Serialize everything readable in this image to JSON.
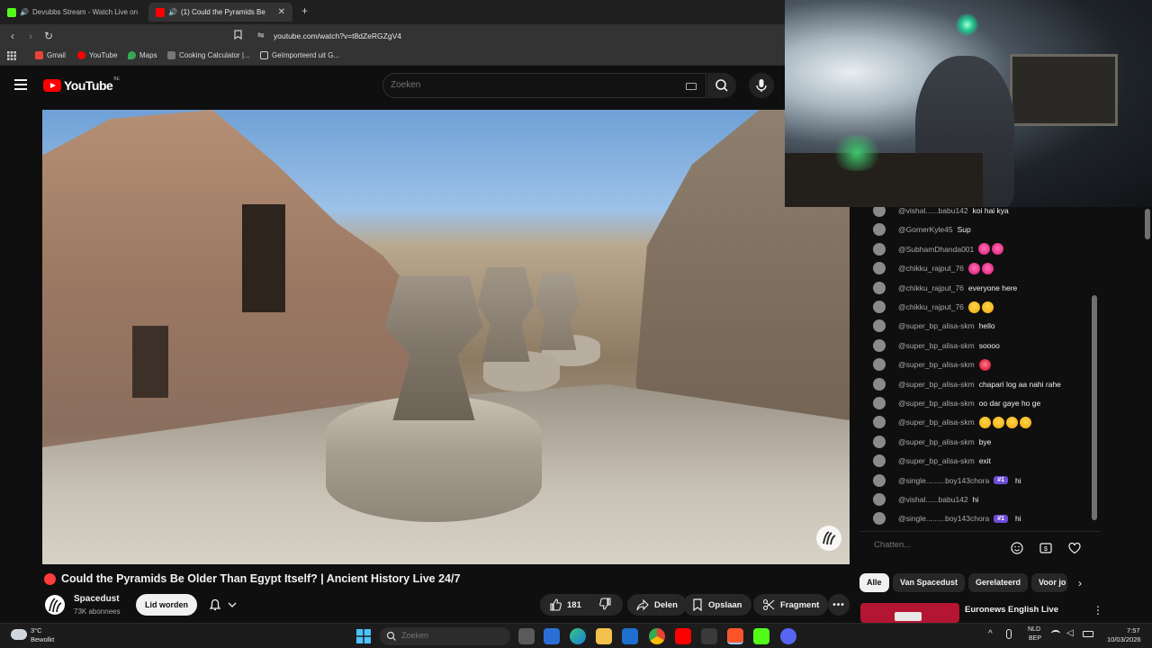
{
  "browser": {
    "tabs": [
      {
        "label": "Devubbs Stream - Watch Live on",
        "favicon_color": "#53fc18"
      },
      {
        "label": "(1)  Could the Pyramids Be",
        "favicon_color": "#ff0000"
      }
    ],
    "url": "youtube.com/watch?v=t8dZeRGZgV4",
    "bookmarks": [
      {
        "label": "Gmail",
        "icon": "gmail-icon"
      },
      {
        "label": "YouTube",
        "icon": "youtube-icon"
      },
      {
        "label": "Maps",
        "icon": "maps-icon"
      },
      {
        "label": "Cooking Calculator |...",
        "icon": "cooking-icon"
      },
      {
        "label": "Geïmporteerd uit G...",
        "icon": "folder-icon"
      }
    ]
  },
  "youtube": {
    "logo_text": "YouTube",
    "country_code": "BE",
    "search_placeholder": "Zoeken"
  },
  "video": {
    "title": "Could the Pyramids Be Older Than Egypt Itself? | Ancient History Live 24/7",
    "channel": "Spacedust",
    "subscribers": "73K abonnees",
    "join_label": "Lid worden",
    "likes": "181",
    "share_label": "Delen",
    "save_label": "Opslaan",
    "clip_label": "Fragment"
  },
  "chat": {
    "messages": [
      {
        "author": "@vishal......babu142",
        "text": "koi hai kya",
        "badge": "",
        "emoji": []
      },
      {
        "author": "@GomerKyle45",
        "text": "Sup",
        "badge": "",
        "emoji": []
      },
      {
        "author": "@SubhamDhanda001",
        "text": "",
        "badge": "",
        "emoji": [
          "hand",
          "hand"
        ]
      },
      {
        "author": "@chikku_rajput_76",
        "text": "",
        "badge": "",
        "emoji": [
          "hand",
          "hand"
        ]
      },
      {
        "author": "@chikku_rajput_76",
        "text": "everyone here",
        "badge": "",
        "emoji": []
      },
      {
        "author": "@chikku_rajput_76",
        "text": "",
        "badge": "",
        "emoji": [
          "laugh",
          "laugh"
        ]
      },
      {
        "author": "@super_bp_alisa-skm",
        "text": "hello",
        "badge": "",
        "emoji": []
      },
      {
        "author": "@super_bp_alisa-skm",
        "text": "soooo",
        "badge": "",
        "emoji": []
      },
      {
        "author": "@super_bp_alisa-skm",
        "text": "",
        "badge": "",
        "emoji": [
          "kiss"
        ]
      },
      {
        "author": "@super_bp_alisa-skm",
        "text": "chapari log aa nahi rahe",
        "badge": "",
        "emoji": []
      },
      {
        "author": "@super_bp_alisa-skm",
        "text": "oo dar gaye ho ge",
        "badge": "",
        "emoji": []
      },
      {
        "author": "@super_bp_alisa-skm",
        "text": "",
        "badge": "",
        "emoji": [
          "laugh",
          "laugh",
          "laugh",
          "laugh"
        ]
      },
      {
        "author": "@super_bp_alisa-skm",
        "text": "bye",
        "badge": "",
        "emoji": []
      },
      {
        "author": "@super_bp_alisa-skm",
        "text": "exit",
        "badge": "",
        "emoji": []
      },
      {
        "author": "@single.........boy143chora",
        "text": "hi",
        "badge": "#1",
        "emoji": []
      },
      {
        "author": "@vishal......babu142",
        "text": "hi",
        "badge": "",
        "emoji": []
      },
      {
        "author": "@single.........boy143chora",
        "text": "hi",
        "badge": "#1",
        "emoji": []
      }
    ],
    "input_placeholder": "Chatten..."
  },
  "chips": [
    "Alle",
    "Van Spacedust",
    "Gerelateerd",
    "Voor jo"
  ],
  "suggestion": {
    "title": "Euronews English Live"
  },
  "taskbar": {
    "weather_temp": "3°C",
    "weather_desc": "Bewolkt",
    "search_placeholder": "Zoeken",
    "lang_line1": "NLD",
    "lang_line2": "BEP",
    "time": "7:57",
    "date": "10/03/2026"
  },
  "colors": {
    "accent": "#ff0000",
    "badge": "#6e4bd8",
    "background": "#0f0f0f"
  }
}
